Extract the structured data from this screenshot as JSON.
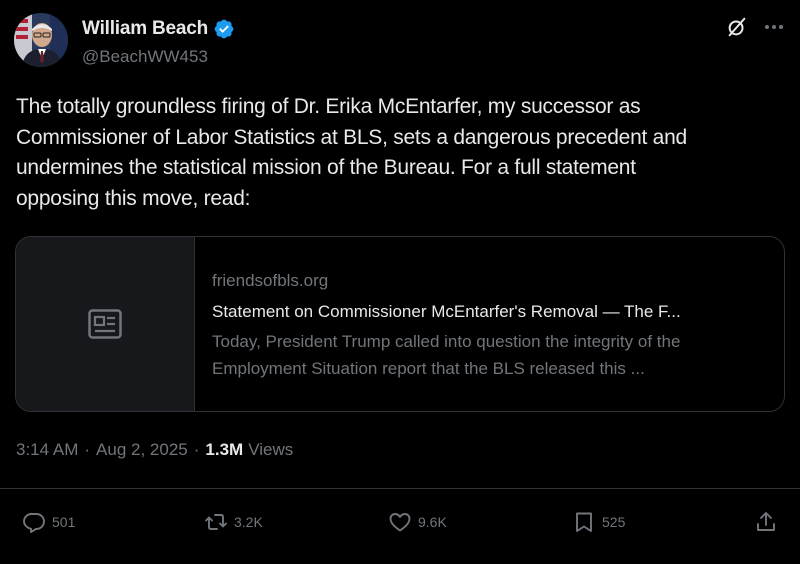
{
  "author": {
    "display_name": "William Beach",
    "handle": "@BeachWW453",
    "verified": true,
    "verified_color": "#1d9bf0"
  },
  "tweet": {
    "text": "The totally groundless firing of Dr. Erika McEntarfer, my successor as\nCommissioner of Labor Statistics at BLS, sets a dangerous precedent and\nundermines the statistical mission of the Bureau.  For a full statement\nopposing this move, read:"
  },
  "card": {
    "domain": "friendsofbls.org",
    "title": "Statement on Commissioner McEntarfer's Removal — The F...",
    "description": "Today, President Trump called into question the integrity of the Employment Situation report that the BLS released this ...",
    "thumbnail_icon": "article-icon"
  },
  "meta": {
    "time": "3:14 AM",
    "separator": "·",
    "date": "Aug 2, 2025",
    "views_count": "1.3M",
    "views_label": "Views"
  },
  "actions": {
    "reply_count": "501",
    "repost_count": "3.2K",
    "like_count": "9.6K",
    "bookmark_count": "525"
  },
  "colors": {
    "background": "#000000",
    "text": "#e7e9ea",
    "secondary": "#71767b",
    "border": "#2f3336"
  }
}
